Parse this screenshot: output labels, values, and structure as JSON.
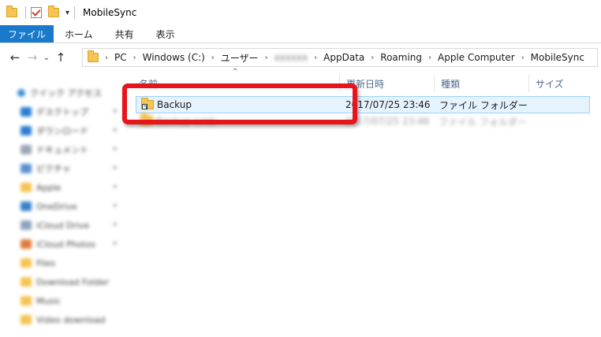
{
  "window": {
    "title": "MobileSync"
  },
  "ribbon": {
    "tabs": [
      "ファイル",
      "ホーム",
      "共有",
      "表示"
    ]
  },
  "address": {
    "crumbs": [
      "PC",
      "Windows (C:)",
      "ユーザー",
      "xxxxxx",
      "AppData",
      "Roaming",
      "Apple Computer",
      "MobileSync"
    ]
  },
  "columns": {
    "name": "名前",
    "modified": "更新日時",
    "type": "種類",
    "size": "サイズ"
  },
  "files": [
    {
      "name": "Backup",
      "modified": "2017/07/25 23:46",
      "type": "ファイル フォルダー",
      "size": ""
    },
    {
      "name": "Backup (old)",
      "modified": "2017/07/25 23:46",
      "type": "ファイル フォルダー",
      "size": ""
    }
  ],
  "sidebar": {
    "items": [
      {
        "label": "クイック アクセス",
        "color": "#3b8fd9"
      },
      {
        "label": "デスクトップ",
        "color": "#2b7cd3"
      },
      {
        "label": "ダウンロード",
        "color": "#2b7cd3"
      },
      {
        "label": "ドキュメント",
        "color": "#9aa7b5"
      },
      {
        "label": "ピクチャ",
        "color": "#5a8fd0"
      },
      {
        "label": "Apple",
        "color": "#f5c451"
      },
      {
        "label": "OneDrive",
        "color": "#3a7fc9"
      },
      {
        "label": "iCloud Drive",
        "color": "#8fa3bf"
      },
      {
        "label": "iCloud Photos",
        "color": "#e07b39"
      },
      {
        "label": "Files",
        "color": "#f5c451"
      },
      {
        "label": "Download Folder",
        "color": "#f5c451"
      },
      {
        "label": "Music",
        "color": "#f5c451"
      },
      {
        "label": "Video download",
        "color": "#f5c451"
      }
    ]
  },
  "colors": {
    "accent": "#1979ca",
    "highlight": "#e8141b",
    "selection": "#e5f3ff"
  }
}
